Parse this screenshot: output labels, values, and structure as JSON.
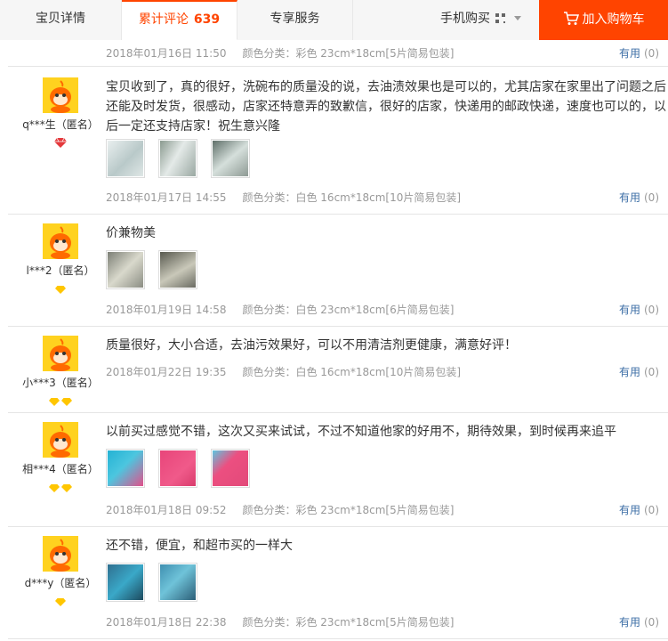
{
  "tabs": {
    "detail": "宝贝详情",
    "reviews": "累计评论",
    "reviews_count": "639",
    "service": "专享服务"
  },
  "mobile_buy": "手机购买",
  "cart_button": "加入购物车",
  "colors": {
    "accent": "#ff4400",
    "link": "#3c6ea6"
  },
  "top_meta": {
    "date": "2018年01月16日 11:50",
    "sku": "颜色分类：彩色 23cm*18cm[5片简易包装]",
    "useful_label": "有用",
    "useful_count": "(0)"
  },
  "reviews": [
    {
      "user": "q***生（匿名）",
      "level_icon": "red-diamond",
      "text": "宝贝收到了，真的很好，洗碗布的质量没的说，去油渍效果也是可以的，尤其店家在家里出了问题之后还能及时发货，很感动，店家还特意弄的致歉信，很好的店家，快递用的邮政快递，速度也可以的，以后一定还支持店家！祝生意兴隆",
      "date": "2018年01月17日 14:55",
      "sku": "颜色分类：白色 16cm*18cm[10片简易包装]",
      "useful_label": "有用",
      "useful_count": "(0)"
    },
    {
      "user": "l***2（匿名）",
      "level_icon": "yellow-diamond",
      "text": "价兼物美",
      "date": "2018年01月19日 14:58",
      "sku": "颜色分类：白色 23cm*18cm[6片简易包装]",
      "useful_label": "有用",
      "useful_count": "(0)"
    },
    {
      "user": "小***3（匿名）",
      "level_icon": "two-yellow-diamonds",
      "text": "质量很好，大小合适，去油污效果好，可以不用清洁剂更健康，满意好评！",
      "date": "2018年01月22日 19:35",
      "sku": "颜色分类：白色 16cm*18cm[10片简易包装]",
      "useful_label": "有用",
      "useful_count": "(0)"
    },
    {
      "user": "相***4（匿名）",
      "level_icon": "two-yellow-diamonds",
      "text": "以前买过感觉不错，这次又买来试试，不过不知道他家的好用不，期待效果，到时候再来追平",
      "date": "2018年01月18日 09:52",
      "sku": "颜色分类：彩色 23cm*18cm[5片简易包装]",
      "useful_label": "有用",
      "useful_count": "(0)"
    },
    {
      "user": "d***y（匿名）",
      "level_icon": "yellow-diamond",
      "text": "还不错，便宜，和超市买的一样大",
      "date": "2018年01月18日 22:38",
      "sku": "颜色分类：彩色 23cm*18cm[5片简易包装]",
      "useful_label": "有用",
      "useful_count": "(0)"
    }
  ]
}
